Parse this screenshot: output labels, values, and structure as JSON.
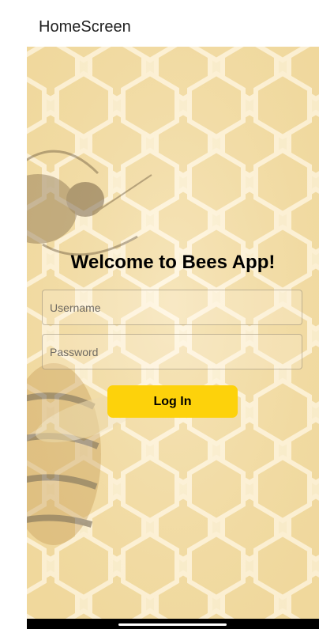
{
  "header": {
    "title": "HomeScreen"
  },
  "main": {
    "welcome_text": "Welcome to Bees App!",
    "username_placeholder": "Username",
    "password_placeholder": "Password",
    "login_label": "Log In"
  },
  "colors": {
    "accent_button": "#fdd20b",
    "honeycomb_background": "#f6e7c2"
  }
}
